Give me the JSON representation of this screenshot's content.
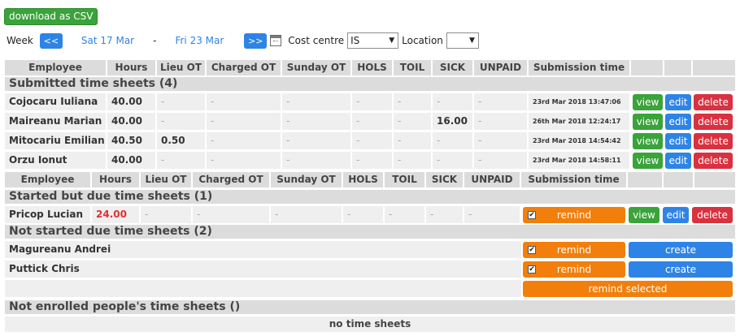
{
  "toolbar": {
    "csv_label": "download as CSV"
  },
  "week": {
    "label": "Week",
    "prev": "<<",
    "start": "Sat 17 Mar",
    "sep": "-",
    "end": "Fri 23 Mar",
    "next": ">>",
    "cost_label": "Cost centre",
    "cost_value": "IS",
    "location_label": "Location",
    "location_value": ""
  },
  "headers": [
    "Employee",
    "Hours",
    "Lieu OT",
    "Charged OT",
    "Sunday OT",
    "HOLS",
    "TOIL",
    "SICK",
    "UNPAID",
    "Submission time"
  ],
  "sections": {
    "submitted": "Submitted time sheets (4)",
    "started": "Started but due time sheets (1)",
    "not_started": "Not started due time sheets (2)",
    "not_enrolled": "Not enrolled people's time sheets ()"
  },
  "submitted": [
    {
      "name": "Cojocaru Iuliana",
      "hours": "40.00",
      "lieu": "-",
      "charged": "-",
      "sunday": "-",
      "hols": "-",
      "toil": "-",
      "sick": "-",
      "unpaid": "-",
      "time": "23rd Mar 2018 13:47:06"
    },
    {
      "name": "Maireanu Marian",
      "hours": "40.00",
      "lieu": "-",
      "charged": "-",
      "sunday": "-",
      "hols": "-",
      "toil": "-",
      "sick": "16.00",
      "unpaid": "-",
      "time": "26th Mar 2018 12:24:17"
    },
    {
      "name": "Mitocariu Emilian",
      "hours": "40.50",
      "lieu": "0.50",
      "charged": "-",
      "sunday": "-",
      "hols": "-",
      "toil": "-",
      "sick": "-",
      "unpaid": "-",
      "time": "23rd Mar 2018 14:54:42"
    },
    {
      "name": "Orzu Ionut",
      "hours": "40.00",
      "lieu": "-",
      "charged": "-",
      "sunday": "-",
      "hols": "-",
      "toil": "-",
      "sick": "-",
      "unpaid": "-",
      "time": "23rd Mar 2018 14:58:11"
    }
  ],
  "started": [
    {
      "name": "Pricop Lucian",
      "hours": "24.00",
      "lieu": "-",
      "charged": "-",
      "sunday": "-",
      "hols": "-",
      "toil": "-",
      "sick": "-",
      "unpaid": "-"
    }
  ],
  "not_started": [
    {
      "name": "Magureanu Andrei"
    },
    {
      "name": "Puttick Chris"
    }
  ],
  "actions": {
    "view": "view",
    "edit": "edit",
    "delete": "delete",
    "remind": "remind",
    "create": "create",
    "remind_selected": "remind selected",
    "check": "✔"
  },
  "not_enrolled_note": "no time sheets"
}
